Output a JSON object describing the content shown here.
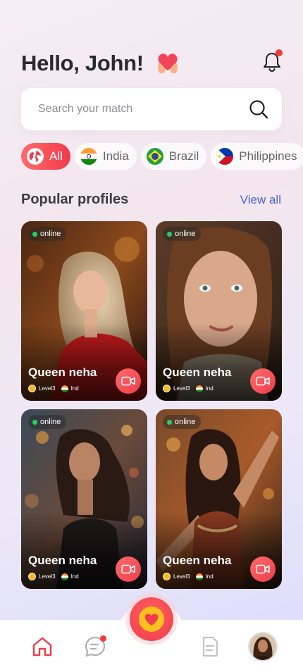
{
  "header": {
    "greeting": "Hello, John!",
    "notification_badge": true
  },
  "search": {
    "placeholder": "Search your match",
    "value": ""
  },
  "filters": [
    {
      "label": "All",
      "icon": "globe-icon",
      "active": true
    },
    {
      "label": "India",
      "icon": "india-flag-icon",
      "active": false
    },
    {
      "label": "Brazil",
      "icon": "brazil-flag-icon",
      "active": false
    },
    {
      "label": "Philippines",
      "icon": "philippines-flag-icon",
      "active": false
    }
  ],
  "section": {
    "title": "Popular profiles",
    "view_all": "View all"
  },
  "profiles": [
    {
      "status": "online",
      "name": "Queen neha",
      "level": "Level3",
      "country": "Ind"
    },
    {
      "status": "online",
      "name": "Queen neha",
      "level": "Level3",
      "country": "Ind"
    },
    {
      "status": "online",
      "name": "Queen neha",
      "level": "Level3",
      "country": "Ind"
    },
    {
      "status": "online",
      "name": "Queen neha",
      "level": "Level3",
      "country": "Ind"
    }
  ],
  "bottom_nav": {
    "items": [
      "home-icon",
      "chat-icon",
      "heart-fab-icon",
      "document-icon",
      "profile-avatar"
    ],
    "chat_badge": true
  },
  "colors": {
    "accent": "#f03b4b",
    "link": "#4c63d8",
    "online": "#28d05c"
  }
}
